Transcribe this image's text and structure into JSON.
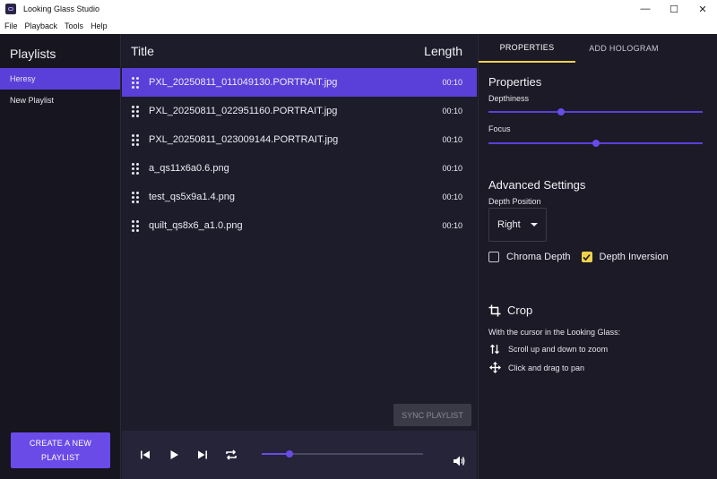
{
  "window": {
    "title": "Looking Glass Studio",
    "controls": [
      "—",
      "☐",
      "✕"
    ]
  },
  "menu": [
    "File",
    "Playback",
    "Tools",
    "Help"
  ],
  "sidebar": {
    "title": "Playlists",
    "items": [
      {
        "label": "Heresy",
        "active": true
      },
      {
        "label": "New Playlist",
        "active": false
      }
    ],
    "create_button_line1": "CREATE A NEW",
    "create_button_line2": "PLAYLIST"
  },
  "list": {
    "title_header": "Title",
    "length_header": "Length",
    "rows": [
      {
        "name": "PXL_20250811_011049130.PORTRAIT.jpg",
        "length": "00:10",
        "active": true
      },
      {
        "name": "PXL_20250811_022951160.PORTRAIT.jpg",
        "length": "00:10",
        "active": false
      },
      {
        "name": "PXL_20250811_023009144.PORTRAIT.jpg",
        "length": "00:10",
        "active": false
      },
      {
        "name": "a_qs11x6a0.6.png",
        "length": "00:10",
        "active": false
      },
      {
        "name": "test_qs5x9a1.4.png",
        "length": "00:10",
        "active": false
      },
      {
        "name": "quilt_qs8x6_a1.0.png",
        "length": "00:10",
        "active": false
      }
    ],
    "sync_button": "SYNC PLAYLIST"
  },
  "player": {
    "progress": 0.17
  },
  "panel": {
    "tabs": [
      {
        "label": "PROPERTIES",
        "active": true
      },
      {
        "label": "ADD HOLOGRAM",
        "active": false
      }
    ],
    "properties_title": "Properties",
    "depthiness_label": "Depthiness",
    "depthiness_value": 0.34,
    "focus_label": "Focus",
    "focus_value": 0.5,
    "advanced_title": "Advanced Settings",
    "depth_position_label": "Depth Position",
    "depth_position_value": "Right",
    "chroma_depth_label": "Chroma Depth",
    "chroma_depth_checked": false,
    "depth_inversion_label": "Depth Inversion",
    "depth_inversion_checked": true,
    "crop_title": "Crop",
    "crop_intro": "With the cursor in the Looking Glass:",
    "crop_zoom": "Scroll up and down to zoom",
    "crop_pan": "Click and drag to pan"
  },
  "colors": {
    "accent": "#5b3fd9",
    "button": "#6a4be8",
    "tab_underline": "#f1d14a",
    "checkbox_checked": "#f1d14a"
  }
}
